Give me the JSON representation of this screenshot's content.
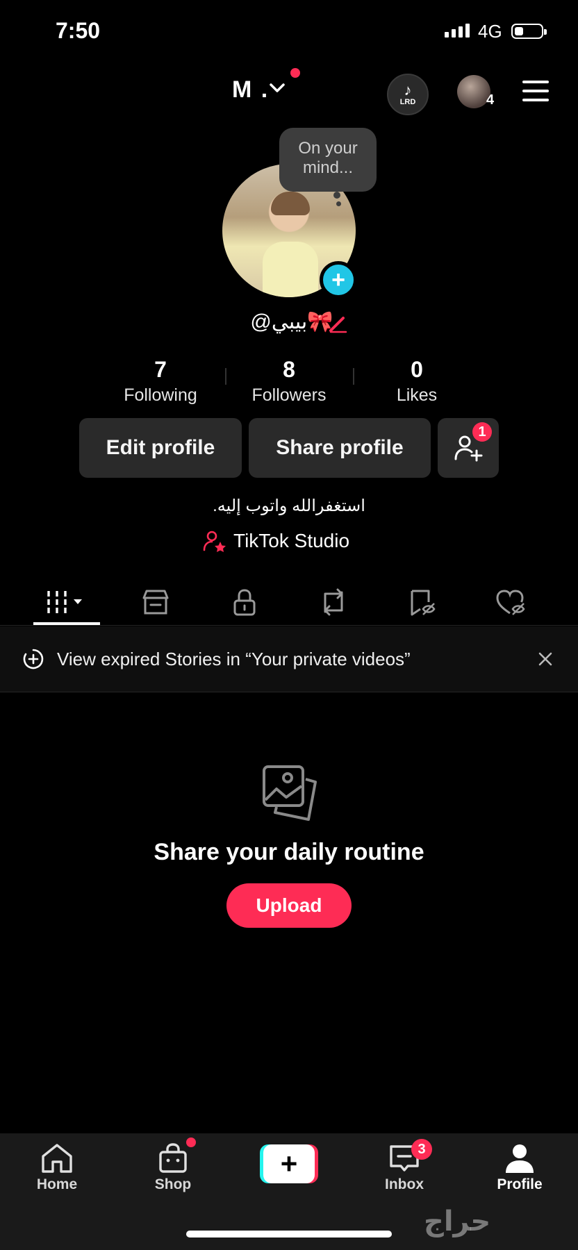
{
  "status_bar": {
    "time": "7:50",
    "network": "4G"
  },
  "header": {
    "username": "M .",
    "lrd_badge": "LRD",
    "friends_count": "4"
  },
  "profile": {
    "thought_bubble": "On your mind...",
    "handle": "🎀بيبي@",
    "stats": [
      {
        "value": "7",
        "label": "Following"
      },
      {
        "value": "8",
        "label": "Followers"
      },
      {
        "value": "0",
        "label": "Likes"
      }
    ],
    "edit_profile": "Edit profile",
    "share_profile": "Share profile",
    "add_friend_badge": "1",
    "bio": "استغفرالله واتوب إليه.",
    "studio_link": "TikTok Studio"
  },
  "tabs": [
    "videos-grid-icon",
    "shop-icon",
    "lock-icon",
    "repost-icon",
    "bookmark-icon",
    "liked-icon"
  ],
  "banner": {
    "text": "View expired Stories in “Your private videos”"
  },
  "empty_state": {
    "title": "Share your daily routine",
    "upload_label": "Upload"
  },
  "nav": {
    "home": "Home",
    "shop": "Shop",
    "inbox": "Inbox",
    "inbox_badge": "3",
    "profile": "Profile"
  },
  "watermark": "حراج",
  "colors": {
    "accent": "#fe2c55",
    "cyan": "#25f4ee",
    "background": "#000000"
  }
}
